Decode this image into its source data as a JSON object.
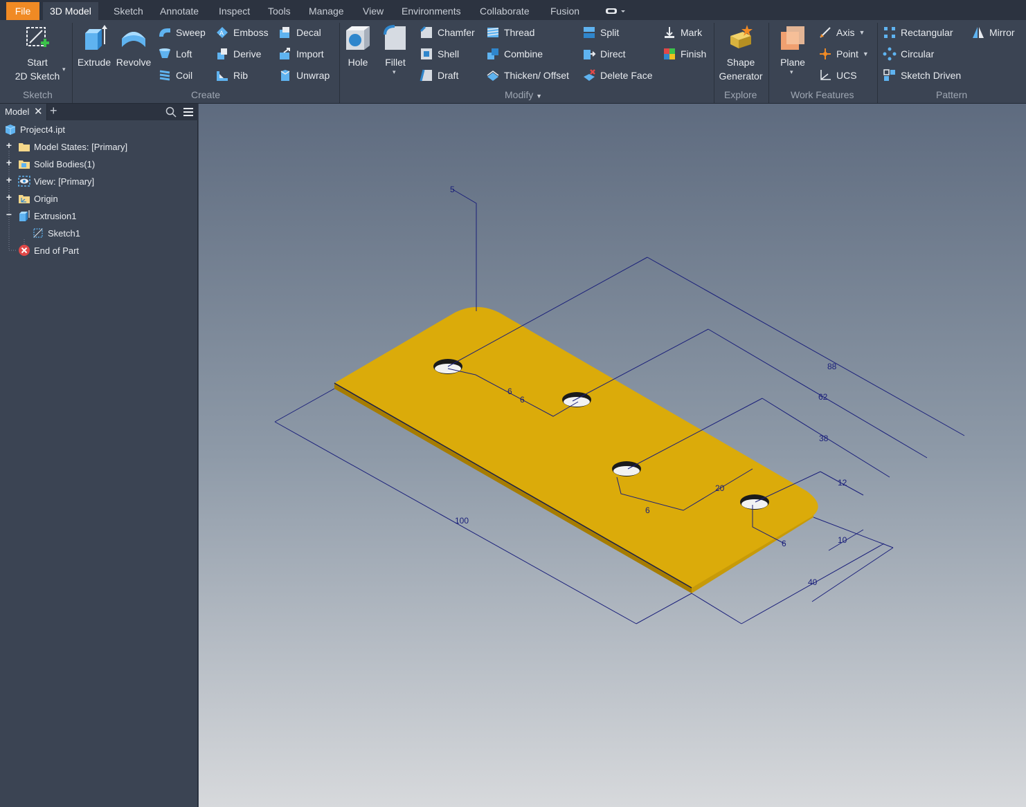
{
  "tabs": [
    {
      "label": "File"
    },
    {
      "label": "3D Model"
    },
    {
      "label": "Sketch"
    },
    {
      "label": "Annotate"
    },
    {
      "label": "Inspect"
    },
    {
      "label": "Tools"
    },
    {
      "label": "Manage"
    },
    {
      "label": "View"
    },
    {
      "label": "Environments"
    },
    {
      "label": "Collaborate"
    },
    {
      "label": "Fusion"
    }
  ],
  "active_tab": "3D Model",
  "ribbon": {
    "sketch": {
      "title": "Sketch",
      "start_line1": "Start",
      "start_line2": "2D Sketch"
    },
    "create": {
      "title": "Create",
      "extrude": "Extrude",
      "revolve": "Revolve",
      "sweep": "Sweep",
      "loft": "Loft",
      "coil": "Coil",
      "emboss": "Emboss",
      "derive": "Derive",
      "rib": "Rib",
      "decal": "Decal",
      "import": "Import",
      "unwrap": "Unwrap"
    },
    "modify": {
      "title": "Modify",
      "hole": "Hole",
      "fillet": "Fillet",
      "chamfer": "Chamfer",
      "shell": "Shell",
      "draft": "Draft",
      "thread": "Thread",
      "combine": "Combine",
      "thicken": "Thicken/ Offset",
      "split": "Split",
      "direct": "Direct",
      "delete_face": "Delete Face",
      "mark": "Mark",
      "finish": "Finish"
    },
    "explore": {
      "title": "Explore",
      "shape_line1": "Shape",
      "shape_line2": "Generator"
    },
    "work": {
      "title": "Work Features",
      "plane": "Plane",
      "axis": "Axis",
      "point": "Point",
      "ucs": "UCS"
    },
    "pattern": {
      "title": "Pattern",
      "rectangular": "Rectangular",
      "circular": "Circular",
      "sketch_driven": "Sketch Driven",
      "mirror": "Mirror"
    }
  },
  "browser": {
    "tab_label": "Model",
    "items": [
      {
        "label": "Project4.ipt"
      },
      {
        "label": "Model States: [Primary]"
      },
      {
        "label": "Solid Bodies(1)"
      },
      {
        "label": "View: [Primary]"
      },
      {
        "label": "Origin"
      },
      {
        "label": "Extrusion1"
      },
      {
        "label": "Sketch1"
      },
      {
        "label": "End of Part"
      }
    ]
  },
  "dimensions": [
    "5",
    "88",
    "62",
    "38",
    "12",
    "6",
    "6",
    "20",
    "6",
    "100",
    "10",
    "6",
    "40"
  ],
  "colors": {
    "part": "#dbab0a",
    "accent": "#f08a24",
    "dimension": "#1a1f7a"
  }
}
